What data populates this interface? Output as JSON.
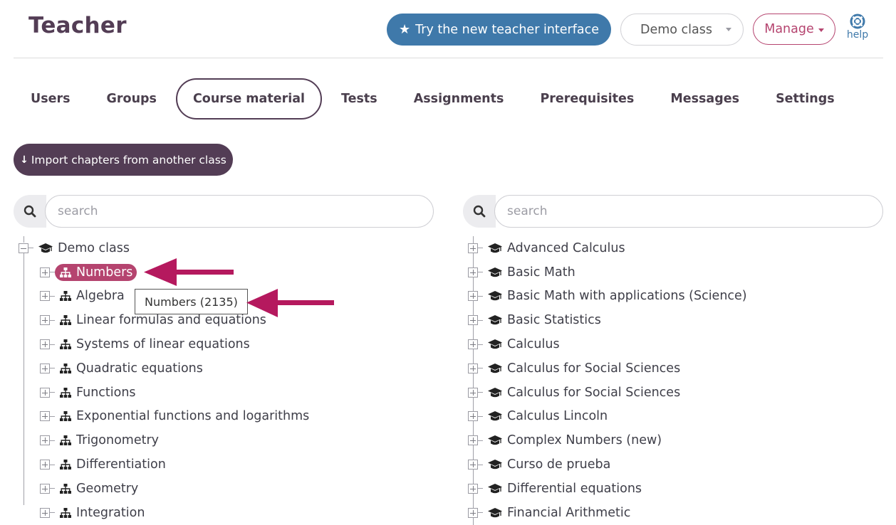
{
  "header": {
    "title": "Teacher",
    "try_button": "Try the new teacher interface",
    "class_select": "Demo class",
    "manage_button": "Manage",
    "help_label": "help"
  },
  "tabs": [
    {
      "label": "Users",
      "active": false
    },
    {
      "label": "Groups",
      "active": false
    },
    {
      "label": "Course material",
      "active": true
    },
    {
      "label": "Tests",
      "active": false
    },
    {
      "label": "Assignments",
      "active": false
    },
    {
      "label": "Prerequisites",
      "active": false
    },
    {
      "label": "Messages",
      "active": false
    },
    {
      "label": "Settings",
      "active": false
    }
  ],
  "import_button": "Import chapters from another class",
  "left_panel": {
    "search_placeholder": "search",
    "root": "Demo class",
    "chapters": [
      "Numbers",
      "Algebra",
      "Linear formulas and equations",
      "Systems of linear equations",
      "Quadratic equations",
      "Functions",
      "Exponential functions and logarithms",
      "Trigonometry",
      "Differentiation",
      "Geometry",
      "Integration"
    ],
    "selected_chapter": "Numbers",
    "tooltip": "Numbers (2135)"
  },
  "right_panel": {
    "search_placeholder": "search",
    "classes": [
      "Advanced Calculus",
      "Basic Math",
      "Basic Math with applications (Science)",
      "Basic Statistics",
      "Calculus",
      "Calculus for Social Sciences",
      "Calculus for Social Sciences",
      "Calculus Lincoln",
      "Complex Numbers (new)",
      "Curso de prueba",
      "Differential equations",
      "Financial Arithmetic"
    ]
  },
  "colors": {
    "primary_purple": "#533d55",
    "accent_pink": "#b5446f",
    "blue": "#3f79aa"
  },
  "icons": {
    "try_button": "star-icon",
    "import_button": "arrow-down-icon",
    "search": "search-icon",
    "help": "lifebuoy-icon",
    "class_node": "graduation-cap-icon",
    "chapter_node": "sitemap-icon",
    "annotation": "arrow-left-icon"
  }
}
